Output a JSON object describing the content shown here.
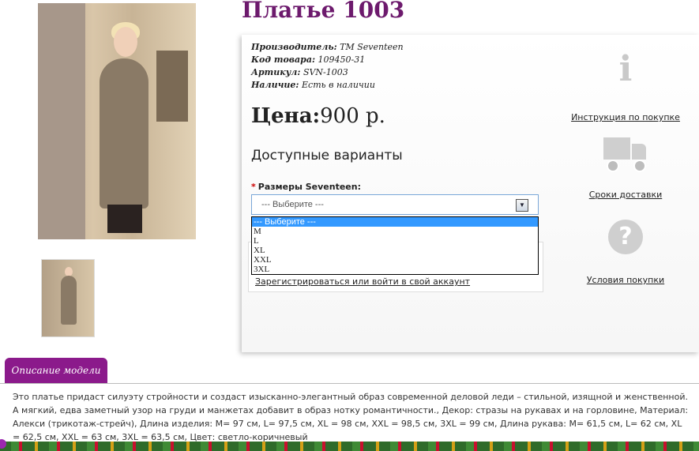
{
  "product": {
    "title": "Платье 1003",
    "manufacturer_label": "Производитель:",
    "manufacturer": "TM Seventeen",
    "code_label": "Код товара:",
    "code": "109450-31",
    "article_label": "Артикул:",
    "article": "SVN-1003",
    "availability_label": "Наличие:",
    "availability": "Есть в наличии",
    "price_label": "Цена:",
    "price": "900 р.",
    "variants_title": "Доступные варианты"
  },
  "size": {
    "label": "Размеры Seventeen:",
    "required_mark": "*",
    "selected": "--- Выберите ---",
    "options": [
      "--- Выберите ---",
      "M",
      "L",
      "XL",
      "XXL",
      "3XL"
    ]
  },
  "login": {
    "link": "Зарегистрироваться или войти в свой аккаунт"
  },
  "sidebar": {
    "instruction": "Инструкция по покупке",
    "delivery": "Сроки доставки",
    "terms": "Условия покупки",
    "icons": [
      "info-icon",
      "truck-icon",
      "question-icon"
    ]
  },
  "description": {
    "tab": "Описание модели",
    "text": "Это платье придаст силуэту стройности и создаст изысканно-элегантный образ современной деловой леди – стильной, изящной и женственной. А мягкий, едва заметный узор на груди и манжетах добавит в образ нотку романтичности., Декор: стразы на рукавах и на горловине, Материал: Алекси (трикотаж-стрейч), Длина изделия: M= 97 см, L= 97,5 см, XL = 98 см, XXL = 98,5 см, 3XL = 99 см, Длина рукава: M= 61,5 см, L= 62 см, XL = 62,5 см, XXL = 63 см, 3XL = 63,5 см, Цвет: светло-коричневый"
  },
  "colors": {
    "title": "#6d1a6d",
    "tab": "#8b1a8b",
    "selection": "#3399ff",
    "required": "#cc0000"
  }
}
